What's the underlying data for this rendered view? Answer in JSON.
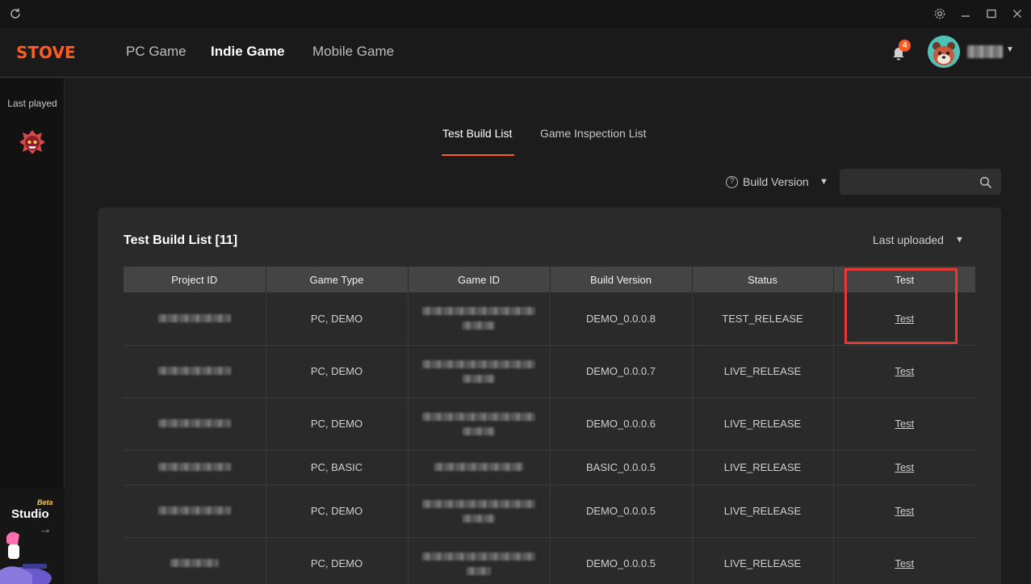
{
  "nav": {
    "logo": "STOVE",
    "links": [
      "PC Game",
      "Indie Game",
      "Mobile Game"
    ],
    "active_index": 1,
    "notification_count": "4"
  },
  "sidebar": {
    "last_played_label": "Last played",
    "studio_beta": "Beta",
    "studio_label": "Studio",
    "studio_arrow": "→"
  },
  "tabs": {
    "items": [
      "Test Build List",
      "Game Inspection List"
    ],
    "active_index": 0
  },
  "filter": {
    "help_icon": "?",
    "build_version_label": "Build Version",
    "search_placeholder": ""
  },
  "list": {
    "title": "Test Build List [11]",
    "sort_label": "Last uploaded",
    "columns": [
      "Project ID",
      "Game Type",
      "Game ID",
      "Build Version",
      "Status",
      "Test"
    ],
    "rows": [
      {
        "game_type": "PC, DEMO",
        "build_version": "DEMO_0.0.0.8",
        "status": "TEST_RELEASE",
        "test": "Test"
      },
      {
        "game_type": "PC, DEMO",
        "build_version": "DEMO_0.0.0.7",
        "status": "LIVE_RELEASE",
        "test": "Test"
      },
      {
        "game_type": "PC, DEMO",
        "build_version": "DEMO_0.0.0.6",
        "status": "LIVE_RELEASE",
        "test": "Test"
      },
      {
        "game_type": "PC, BASIC",
        "build_version": "BASIC_0.0.0.5",
        "status": "LIVE_RELEASE",
        "test": "Test"
      },
      {
        "game_type": "PC, DEMO",
        "build_version": "DEMO_0.0.0.5",
        "status": "LIVE_RELEASE",
        "test": "Test"
      },
      {
        "game_type": "PC, DEMO",
        "build_version": "DEMO_0.0.0.5",
        "status": "LIVE_RELEASE",
        "test": "Test"
      }
    ]
  },
  "colors": {
    "accent": "#ff5a1f",
    "highlight": "#e53935"
  }
}
